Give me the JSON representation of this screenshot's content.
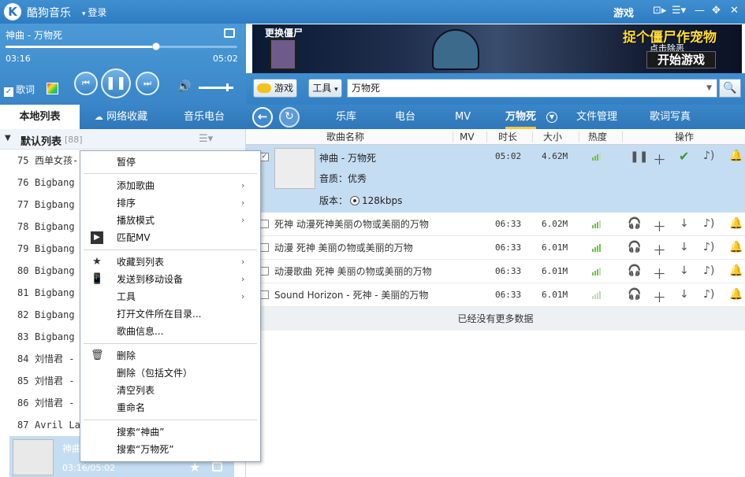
{
  "app": {
    "title": "酷狗音乐",
    "login": "登录",
    "logo": "K",
    "game_label": "游戏"
  },
  "player": {
    "song": "神曲 - 万物死",
    "elapsed": "03:16",
    "total": "05:02",
    "progress": 0.65,
    "volume": 0.8,
    "lyric_label": "歌词",
    "lyric_checked": true
  },
  "banner": {
    "left_label": "更换僵尸",
    "title": "捉个僵尸作宠物",
    "sub": "点击除恶",
    "start": "开始游戏"
  },
  "toolbar": {
    "games_label": "游戏",
    "tools_label": "工具",
    "search_value": "万物死"
  },
  "left_tabs": [
    "本地列表",
    "网络收藏",
    "音乐电台"
  ],
  "left_list": {
    "header_title": "默认列表",
    "header_count": "[88]",
    "rows": [
      {
        "num": "75",
        "name": "西单女孩-"
      },
      {
        "num": "76",
        "name": "Bigbang -"
      },
      {
        "num": "77",
        "name": "Bigbang -"
      },
      {
        "num": "78",
        "name": "Bigbang -"
      },
      {
        "num": "79",
        "name": "Bigbang -"
      },
      {
        "num": "80",
        "name": "Bigbang -"
      },
      {
        "num": "81",
        "name": "Bigbang -"
      },
      {
        "num": "82",
        "name": "Bigbang -"
      },
      {
        "num": "83",
        "name": "Bigbang -"
      },
      {
        "num": "84",
        "name": "刘惜君 -"
      },
      {
        "num": "85",
        "name": "刘惜君 -"
      },
      {
        "num": "86",
        "name": "刘惜君 -"
      },
      {
        "num": "87",
        "name": "Avril Lav"
      }
    ],
    "current": {
      "title": "神曲",
      "time": "03:16/05:02"
    }
  },
  "right_nav": [
    "乐库",
    "电台",
    "MV",
    "万物死",
    "文件管理",
    "歌词写真"
  ],
  "table": {
    "headers": {
      "name": "歌曲名称",
      "mv": "MV",
      "duration": "时长",
      "size": "大小",
      "heat": "热度",
      "ops": "操作"
    },
    "expanded": {
      "title": "神曲 - 万物死",
      "quality": "音质：优秀",
      "version_label": "版本：",
      "version": "128kbps",
      "duration": "05:02",
      "size": "4.62M",
      "heat": 3
    },
    "rows": [
      {
        "title": "死神 动漫死神美丽の物或美丽的万物",
        "duration": "06:33",
        "size": "6.02M",
        "heat": 3
      },
      {
        "title": "动漫 死神 美丽の物或美丽的万物",
        "duration": "06:33",
        "size": "6.01M",
        "heat": 4
      },
      {
        "title": "动漫歌曲 死神 美丽の物或美丽的万物",
        "duration": "06:33",
        "size": "6.01M",
        "heat": 3
      },
      {
        "title": "Sound Horizon - 死神 - 美丽的万物",
        "duration": "06:33",
        "size": "6.01M",
        "heat": 0
      }
    ],
    "no_more": "已经没有更多数据"
  },
  "context_menu": {
    "pause": "暂停",
    "add_song": "添加歌曲",
    "sort": "排序",
    "play_mode": "播放模式",
    "match_mv": "匹配MV",
    "collect": "收藏到列表",
    "send_mobile": "发送到移动设备",
    "tools": "工具",
    "open_dir": "打开文件所在目录...",
    "song_info": "歌曲信息...",
    "delete": "删除",
    "delete_files": "删除（包括文件）",
    "clear_list": "清空列表",
    "rename": "重命名",
    "search_a": "搜索“神曲”",
    "search_b": "搜索“万物死”"
  }
}
